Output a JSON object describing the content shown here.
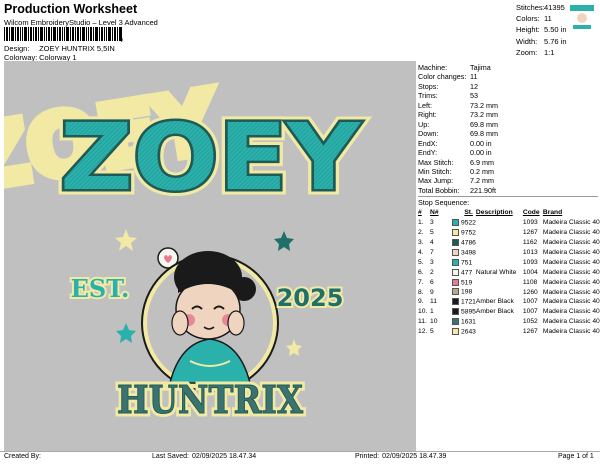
{
  "header": {
    "title": "Production Worksheet",
    "subtitle": "Wilcom EmbroideryStudio – Level 3 Advanced",
    "barcode_comma": ","
  },
  "meta": {
    "design_label": "Design:",
    "design_value": "ZOEY HUNTRIX 5,5IN",
    "colorway_label": "Colorway:",
    "colorway_value": "Colorway 1"
  },
  "stats": [
    {
      "k": "Stitches:",
      "v": "41395"
    },
    {
      "k": "Colors:",
      "v": "11"
    },
    {
      "k": "Height:",
      "v": "5.50 in"
    },
    {
      "k": "Width:",
      "v": "5.76 in"
    },
    {
      "k": "Zoom:",
      "v": "1:1"
    }
  ],
  "design": {
    "top_word": "ZOEY",
    "est": "EST.",
    "year": "2025",
    "bottom_word": "HUNTRIX"
  },
  "info": [
    {
      "k": "Machine:",
      "v": "Tajima"
    },
    {
      "k": "Color changes:",
      "v": "11"
    },
    {
      "k": "Stops:",
      "v": "12"
    },
    {
      "k": "Trims:",
      "v": "53"
    },
    {
      "k": "Left:",
      "v": "73.2 mm"
    },
    {
      "k": "Right:",
      "v": "73.2 mm"
    },
    {
      "k": "Up:",
      "v": "69.8 mm"
    },
    {
      "k": "Down:",
      "v": "69.8 mm"
    },
    {
      "k": "EndX:",
      "v": "0.00 in"
    },
    {
      "k": "EndY:",
      "v": "0.00 in"
    },
    {
      "k": "Max Stitch:",
      "v": "6.9 mm"
    },
    {
      "k": "Min Stitch:",
      "v": "0.2 mm"
    },
    {
      "k": "Max Jump:",
      "v": "7.2 mm"
    },
    {
      "k": "Total Bobbin:",
      "v": "221.90ft"
    }
  ],
  "stop_sequence": {
    "title": "Stop Sequence:",
    "headers": [
      "#",
      "N#",
      "St.",
      "Description",
      "Code",
      "Brand"
    ],
    "rows": [
      {
        "n": "1.",
        "needle": "3",
        "color": "#2bb1ac",
        "st": "9522",
        "desc": "",
        "code": "1093",
        "brand": "Madeira Classic 40"
      },
      {
        "n": "2.",
        "needle": "5",
        "color": "#f1e9a4",
        "st": "9752",
        "desc": "",
        "code": "1267",
        "brand": "Madeira Classic 40"
      },
      {
        "n": "3.",
        "needle": "4",
        "color": "#1f5a54",
        "st": "4786",
        "desc": "",
        "code": "1162",
        "brand": "Madeira Classic 40"
      },
      {
        "n": "4.",
        "needle": "7",
        "color": "#efd5bf",
        "st": "3498",
        "desc": "",
        "code": "1013",
        "brand": "Madeira Classic 40"
      },
      {
        "n": "5.",
        "needle": "3",
        "color": "#2bb1ac",
        "st": "751",
        "desc": "",
        "code": "1093",
        "brand": "Madeira Classic 40"
      },
      {
        "n": "6.",
        "needle": "2",
        "color": "#f7f7f2",
        "st": "477",
        "desc": "Natural White",
        "code": "1004",
        "brand": "Madeira Classic 40"
      },
      {
        "n": "7.",
        "needle": "6",
        "color": "#e67a8e",
        "st": "519",
        "desc": "",
        "code": "1108",
        "brand": "Madeira Classic 40"
      },
      {
        "n": "8.",
        "needle": "9",
        "color": "#b9a98a",
        "st": "198",
        "desc": "",
        "code": "1260",
        "brand": "Madeira Classic 40"
      },
      {
        "n": "9.",
        "needle": "11",
        "color": "#1a1a1a",
        "st": "1721",
        "desc": "Amber Black",
        "code": "1007",
        "brand": "Madeira Classic 40"
      },
      {
        "n": "10.",
        "needle": "1",
        "color": "#1a1a1a",
        "st": "5895",
        "desc": "Amber Black",
        "code": "1007",
        "brand": "Madeira Classic 40"
      },
      {
        "n": "11.",
        "needle": "10",
        "color": "#3b7370",
        "st": "1631",
        "desc": "",
        "code": "1052",
        "brand": "Madeira Classic 40"
      },
      {
        "n": "12.",
        "needle": "5",
        "color": "#f1e9a4",
        "st": "2643",
        "desc": "",
        "code": "1267",
        "brand": "Madeira Classic 40"
      }
    ]
  },
  "footer": {
    "created_label": "Created By:",
    "saved_label": "Last Saved:",
    "saved_value": "02/09/2025 18.47.34",
    "printed_label": "Printed:",
    "printed_value": "02/09/2025 18.47.39",
    "page": "Page 1 of 1"
  },
  "colors": {
    "teal": "#2bb1ac",
    "cream": "#f1e9a4",
    "dark_teal": "#1f5a54",
    "background": "#c0c0c0"
  }
}
